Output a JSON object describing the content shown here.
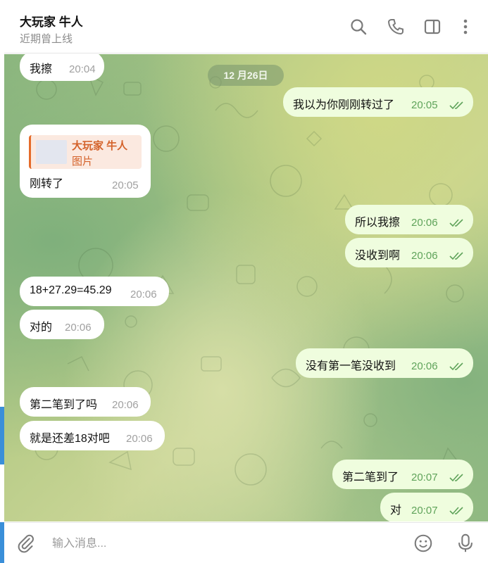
{
  "header": {
    "title": "大玩家 牛人",
    "status": "近期曾上线",
    "icons": [
      "search-icon",
      "phone-icon",
      "sidebar-toggle-icon",
      "more-vertical-icon"
    ]
  },
  "chat": {
    "date": "12 月26日",
    "messages": [
      {
        "dir": "in",
        "text": "我擦",
        "time": "20:04"
      },
      {
        "dir": "out",
        "text": "我以为你刚刚转过了",
        "time": "20:05",
        "read": true
      },
      {
        "dir": "in",
        "reply_to": {
          "name": "大玩家 牛人",
          "type": "图片"
        },
        "text": "刚转了",
        "time": "20:05"
      },
      {
        "dir": "out",
        "text": "所以我擦",
        "time": "20:06",
        "read": true
      },
      {
        "dir": "out",
        "text": "没收到啊",
        "time": "20:06",
        "read": true
      },
      {
        "dir": "in",
        "text": "18+27.29=45.29",
        "time": "20:06"
      },
      {
        "dir": "in",
        "text": "对的",
        "time": "20:06"
      },
      {
        "dir": "out",
        "text": "没有第一笔没收到",
        "time": "20:06",
        "read": true
      },
      {
        "dir": "in",
        "text": "第二笔到了吗",
        "time": "20:06"
      },
      {
        "dir": "in",
        "text": "就是还差18对吧",
        "time": "20:06"
      },
      {
        "dir": "out",
        "text": "第二笔到了",
        "time": "20:07",
        "read": true
      },
      {
        "dir": "out",
        "text": "对",
        "time": "20:07",
        "read": true
      }
    ]
  },
  "composer": {
    "placeholder": "输入消息...",
    "icons": [
      "attach-icon",
      "emoji-icon",
      "microphone-icon"
    ]
  },
  "colors": {
    "incoming_bubble": "#ffffff",
    "outgoing_bubble": "#effdde",
    "outgoing_time": "#5fa35a",
    "reply_accent": "#e56b2a",
    "left_accent": "#3a8fd9"
  }
}
